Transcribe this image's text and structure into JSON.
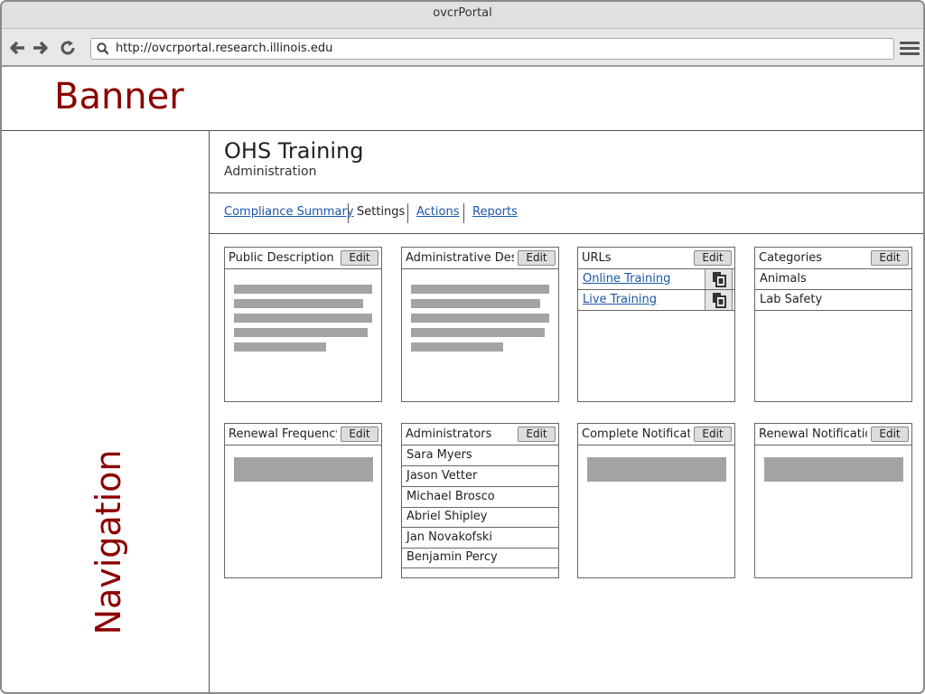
{
  "browser": {
    "title": "ovcrPortal",
    "url": "http://ovcrportal.research.illinois.edu"
  },
  "banner": {
    "text": "Banner"
  },
  "navigation": {
    "text": "Navigation"
  },
  "page": {
    "title": "OHS Training",
    "subtitle": "Administration"
  },
  "tabs": [
    {
      "label": "Compliance Summary"
    },
    {
      "label": "Settings"
    },
    {
      "label": "Actions"
    },
    {
      "label": "Reports"
    }
  ],
  "edit_label": "Edit",
  "panels": {
    "public_description": {
      "title": "Public Description"
    },
    "administrative_description": {
      "title": "Administrative Description"
    },
    "urls": {
      "title": "URLs",
      "items": [
        {
          "label": "Online Training"
        },
        {
          "label": "Live Training"
        }
      ]
    },
    "categories": {
      "title": "Categories",
      "items": [
        {
          "label": "Animals"
        },
        {
          "label": "Lab Safety"
        }
      ]
    },
    "renewal_frequency": {
      "title": "Renewal Frequency"
    },
    "administrators": {
      "title": "Administrators",
      "items": [
        {
          "label": "Sara Myers"
        },
        {
          "label": "Jason Vetter"
        },
        {
          "label": "Michael Brosco"
        },
        {
          "label": "Abriel Shipley"
        },
        {
          "label": "Jan Novakofski"
        },
        {
          "label": "Benjamin Percy"
        }
      ]
    },
    "complete_notification": {
      "title": "Complete Notification"
    },
    "renewal_notification": {
      "title": "Renewal Notification"
    }
  },
  "icons": {
    "back": "arrow-left-icon",
    "forward": "arrow-right-icon",
    "reload": "reload-icon",
    "search": "search-icon",
    "menu": "hamburger-menu-icon",
    "copy": "copy-icon"
  }
}
